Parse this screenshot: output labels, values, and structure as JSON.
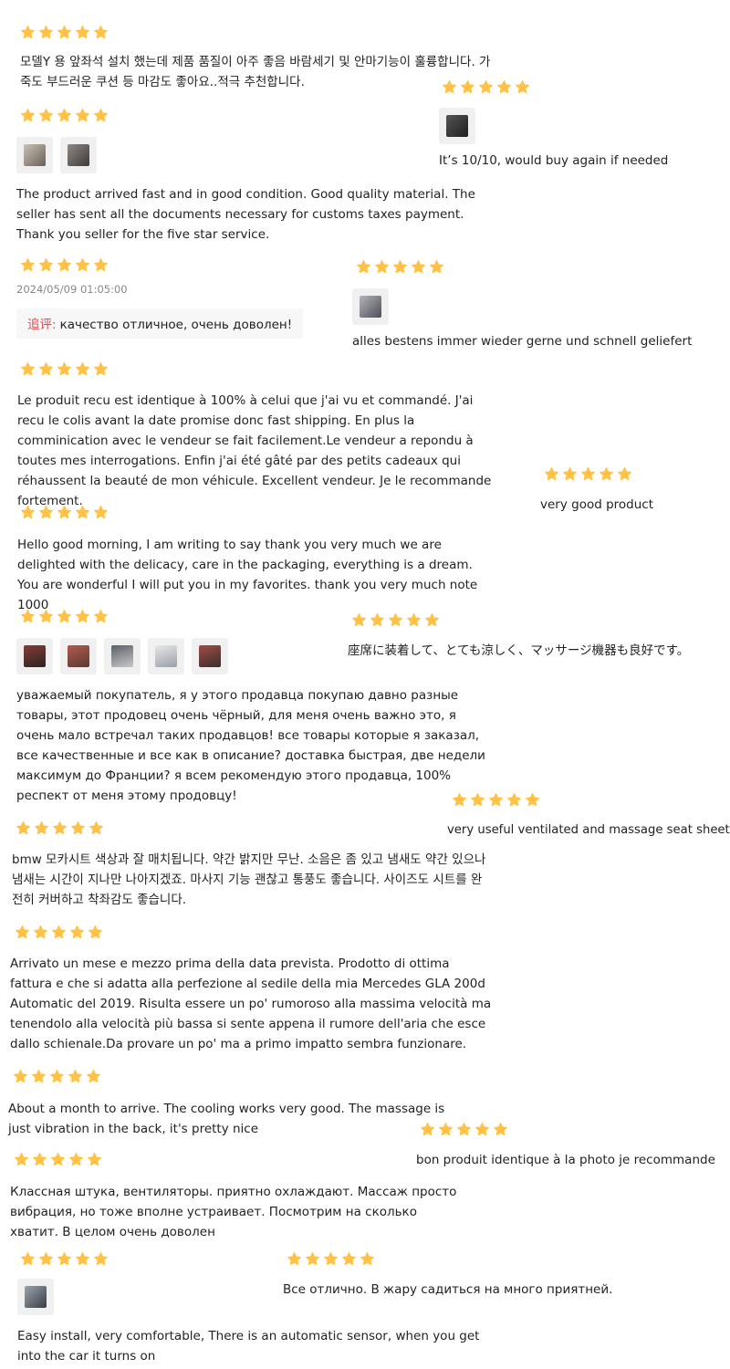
{
  "star_color": "#ffc246",
  "reviews": [
    {
      "text": "모델Y 용 앞좌석 설치 했는데 제품 품질이 아주 좋음 바람세기 및 안마기능이 훌륭합니다. 가죽도 부드러운 쿠션 등 마감도 좋아요..적극 추천합니다."
    },
    {
      "text": "The product arrived fast and in good condition. Good quality material. The seller has sent all the documents necessary for customs taxes payment. Thank you seller for the five star service."
    },
    {
      "date": "2024/05/09 01:05:00",
      "followup_label": "追评:",
      "followup_text": "качество отличное, очень доволен!"
    },
    {
      "text": "Le produit recu est identique à 100% à celui que j'ai vu et commandé. J'ai recu le colis avant la date promise donc fast shipping. En plus la comminication avec le vendeur se fait facilement.Le vendeur a repondu à toutes mes interrogations. Enfin j'ai été gâté par des petits cadeaux qui réhaussent la beauté de mon véhicule. Excellent vendeur. Je le recommande fortement."
    },
    {
      "text": "Hello good morning, I am writing to say thank you very much we are delighted with the delicacy, care in the packaging, everything is a dream. You are wonderful I will put you in my favorites. thank you very much note 1000"
    },
    {
      "text": "уважаемый покупатель, я у этого продавца покупаю давно разные товары, этот продовец очень чёрный, для меня очень важно это, я очень мало встречал таких продавцов! все товары которые я заказал, все качественные и все как в описание? доставка быстрая, две недели максимум до Франции? я всем рекомендую этого продавца, 100% респект от меня этому продовцу!"
    },
    {
      "text": "bmw 모카시트 색상과 잘 매치됩니다. 약간 밝지만 무난. 소음은 좀 있고 냄새도 약간 있으나 냄새는 시간이 지나만 나아지겠죠. 마사지 기능 괜찮고 통풍도 좋습니다. 사이즈도 시트를 완전히 커버하고 착좌감도 좋습니다."
    },
    {
      "text": "Arrivato un mese e mezzo prima della data prevista. Prodotto di ottima fattura e che si adatta alla perfezione al sedile della mia Mercedes GLA 200d Automatic del 2019. Risulta essere un po' rumoroso alla massima velocità ma tenendolo alla velocità più bassa si sente appena il rumore dell'aria che esce dallo schienale.Da provare un po' ma a primo impatto sembra funzionare."
    },
    {
      "text": "About a month to arrive. The cooling works very good. The massage is just vibration in the back, it's pretty nice"
    },
    {
      "text": "Классная штука, вентиляторы. приятно охлаждают. Массаж просто вибрация, но тоже вполне устраивает. Посмотрим на сколько хватит. В целом очень доволен"
    },
    {
      "text": "Easy install, very comfortable, There is an automatic sensor, when you get into the car it turns on"
    },
    {
      "text": "It’s 10/10, would buy again if needed"
    },
    {
      "text": "alles bestens immer wieder gerne und schnell geliefert"
    },
    {
      "text": "very good product"
    },
    {
      "text": "座席に装着して、とても涼しく、マッサージ機器も良好です。"
    },
    {
      "text": "very useful ventilated and massage seat sheet"
    },
    {
      "text": "bon produit identique à la photo je recommande"
    },
    {
      "text": "Все отлично. В жару садиться на много приятней."
    }
  ]
}
